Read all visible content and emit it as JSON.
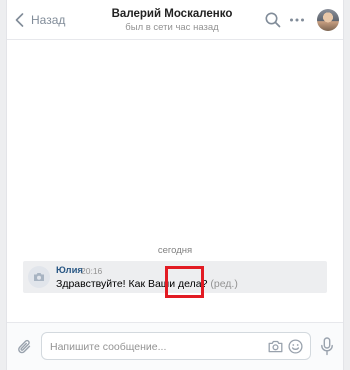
{
  "header": {
    "back_label": "Назад",
    "contact_name": "Валерий Москаленко",
    "last_seen": "был в сети час назад",
    "icons": [
      "chevron-left-icon",
      "search-icon",
      "more-icon"
    ]
  },
  "conversation": {
    "date_separator": "сегодня",
    "messages": [
      {
        "author": "Юлия",
        "time": "20:16",
        "text": "Здравствуйте! Как Ваши дела?",
        "edited_label": "(ред.)"
      }
    ]
  },
  "composer": {
    "placeholder": "Напишите сообщение...",
    "icons": [
      "paperclip-icon",
      "camera-icon",
      "smile-icon",
      "microphone-icon"
    ]
  },
  "colors": {
    "accent_link": "#2a5885",
    "highlight": "#e21b23",
    "secondary_text": "#939393"
  }
}
